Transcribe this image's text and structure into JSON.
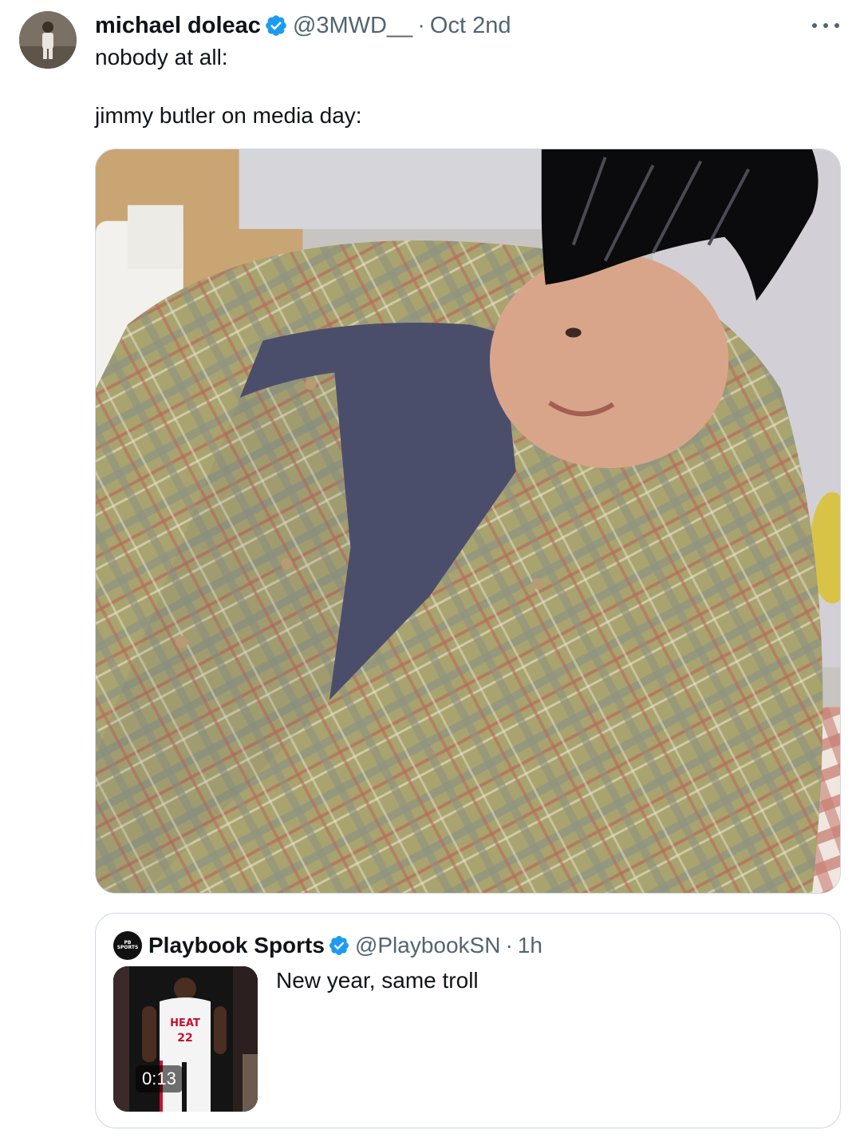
{
  "tweet": {
    "display_name": "michael doleac",
    "handle": "@3MWD__",
    "separator": "·",
    "date": "Oct 2nd",
    "text_line1": "nobody at all:",
    "text_line2": "jimmy butler on media day:"
  },
  "quote": {
    "display_name": "Playbook Sports",
    "handle": "@PlaybookSN",
    "separator": "·",
    "time": "1h",
    "text": "New year, same troll",
    "video_duration": "0:13"
  },
  "icons": {
    "verified": "verified-badge-icon",
    "more": "more-options-icon"
  },
  "colors": {
    "verified": "#1d9bf0",
    "secondary_text": "#536471",
    "border": "#cfd9de"
  }
}
